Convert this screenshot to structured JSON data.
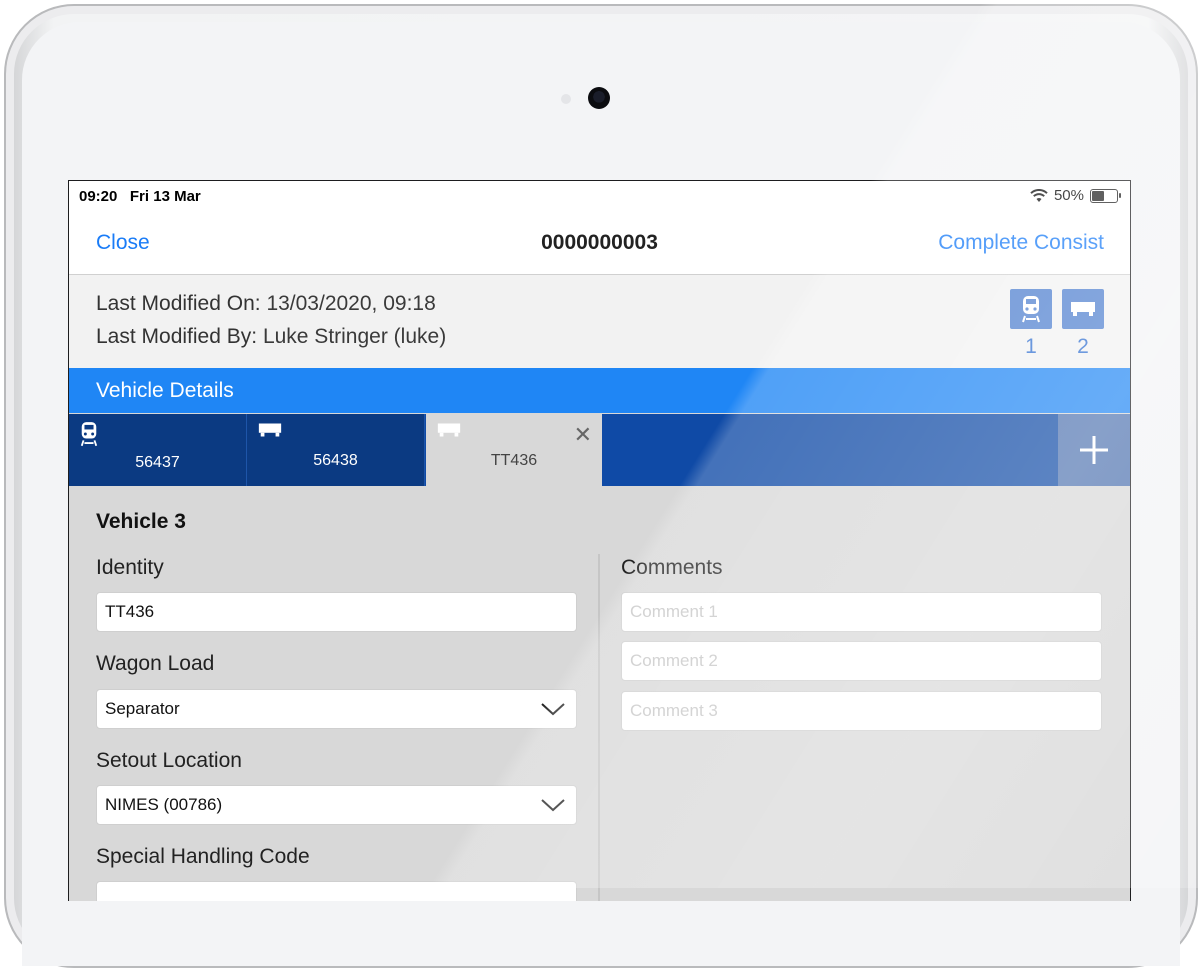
{
  "status_bar": {
    "time": "09:20",
    "date": "Fri 13 Mar",
    "battery": "50%"
  },
  "nav": {
    "close_label": "Close",
    "title": "0000000003",
    "complete_label": "Complete Consist"
  },
  "meta": {
    "modified_on_label": "Last Modified On:",
    "modified_on_value": "13/03/2020, 09:18",
    "modified_by_label": "Last Modified By:",
    "modified_by_value": "Luke Stringer (luke)",
    "counts": [
      {
        "icon": "locomotive-icon",
        "value": "1"
      },
      {
        "icon": "wagon-icon",
        "value": "2"
      }
    ]
  },
  "section": {
    "title": "Vehicle Details"
  },
  "tabs": [
    {
      "label": "56437",
      "icon": "locomotive-icon"
    },
    {
      "label": "56438",
      "icon": "wagon-icon"
    },
    {
      "label": "TT436",
      "icon": "wagon-icon",
      "active": true
    }
  ],
  "vehicle": {
    "title": "Vehicle 3",
    "identity_label": "Identity",
    "identity_value": "TT436",
    "wagon_load_label": "Wagon Load",
    "wagon_load_value": "Separator",
    "setout_label": "Setout Location",
    "setout_value": "NIMES (00786)",
    "special_label": "Special Handling Code",
    "comments_label": "Comments",
    "comments": [
      "Comment 1",
      "Comment 2",
      "Comment 3"
    ]
  },
  "colors": {
    "accent": "#1a7cf7",
    "section_bar": "#1f86f5",
    "tab_bar": "#0b3a82",
    "count_icon_bg": "#4e7fcf"
  }
}
